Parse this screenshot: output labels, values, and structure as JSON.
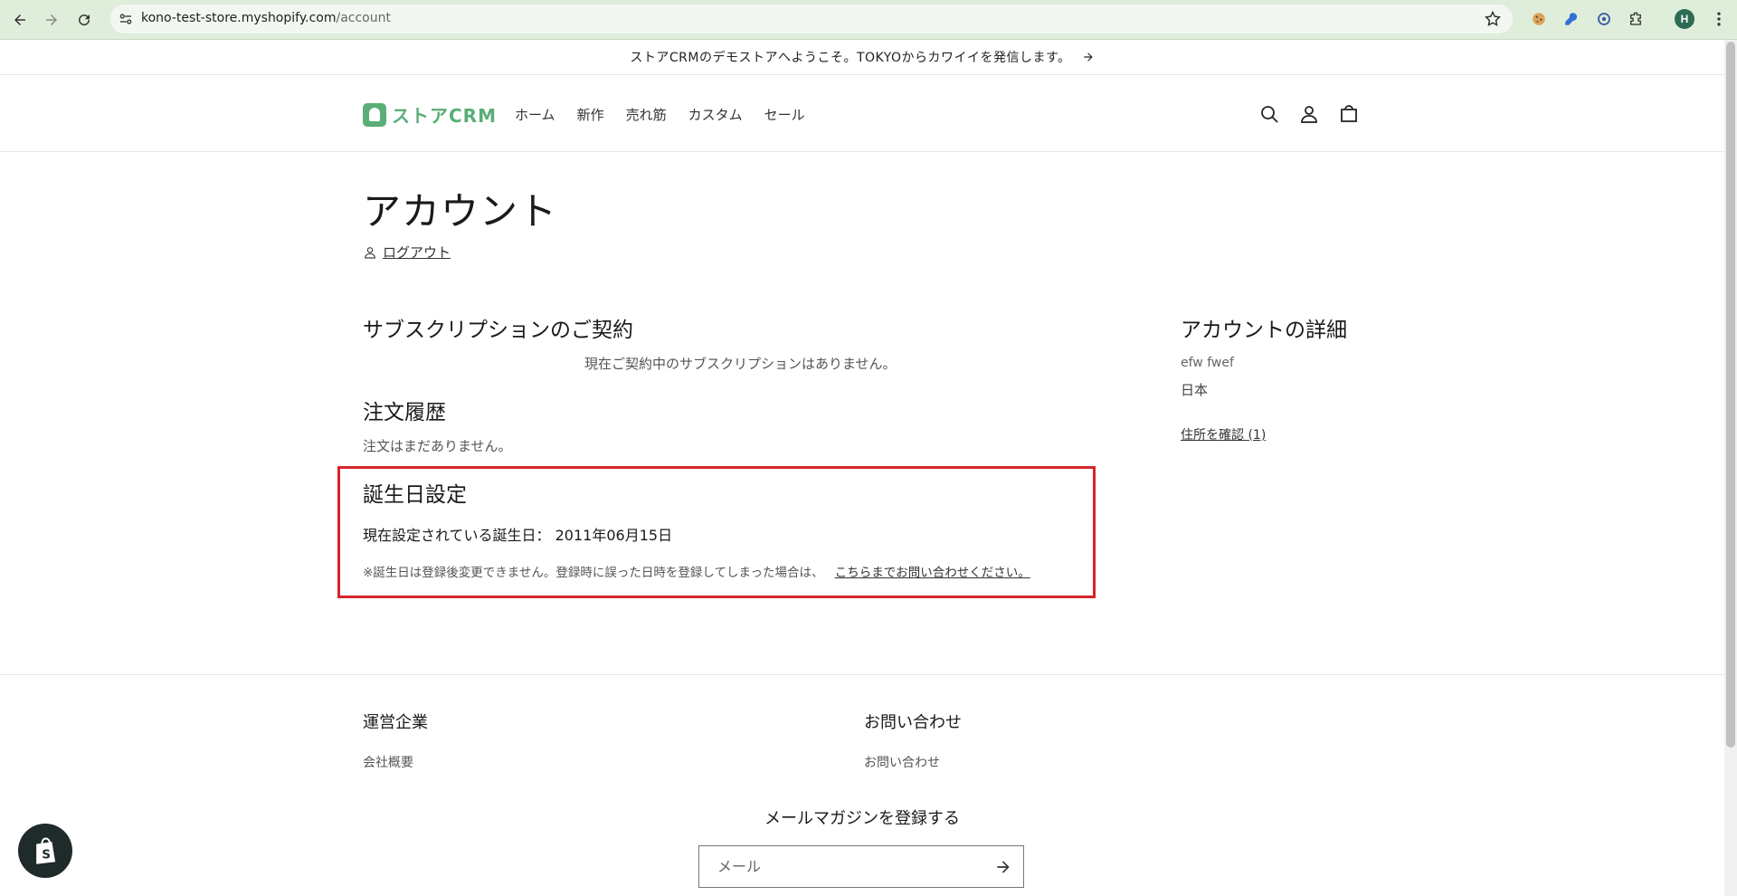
{
  "browser": {
    "url_host": "kono-test-store.myshopify.com",
    "url_path": "/account",
    "profile_initial": "H"
  },
  "announcement": {
    "text": "ストアCRMのデモストアへようこそ。TOKYOからカワイイを発信します。"
  },
  "header": {
    "logo_text": "ストアCRM",
    "nav": [
      "ホーム",
      "新作",
      "売れ筋",
      "カスタム",
      "セール"
    ]
  },
  "account": {
    "title": "アカウント",
    "logout_label": "ログアウト"
  },
  "subscriptions": {
    "title": "サブスクリプションのご契約",
    "empty_text": "現在ご契約中のサブスクリプションはありません。"
  },
  "orders": {
    "title": "注文履歴",
    "empty_text": "注文はまだありません。"
  },
  "birthday": {
    "title": "誕生日設定",
    "current_label": "現在設定されている誕生日：",
    "current_value": "2011年06月15日",
    "note": "※誕生日は登録後変更できません。登録時に誤った日時を登録してしまった場合は、",
    "contact_link": "こちらまでお問い合わせください。"
  },
  "details": {
    "title": "アカウントの詳細",
    "name": "efw fwef",
    "country": "日本",
    "address_link": "住所を確認 (1)"
  },
  "footer": {
    "company_title": "運営企業",
    "company_link": "会社概要",
    "contact_title": "お問い合わせ",
    "contact_link": "お問い合わせ",
    "newsletter_title": "メールマガジンを登録する",
    "email_placeholder": "メール"
  },
  "colors": {
    "brand": "#5aae77",
    "highlight_border": "#d6262a",
    "chrome_bg": "#dfeedb"
  }
}
